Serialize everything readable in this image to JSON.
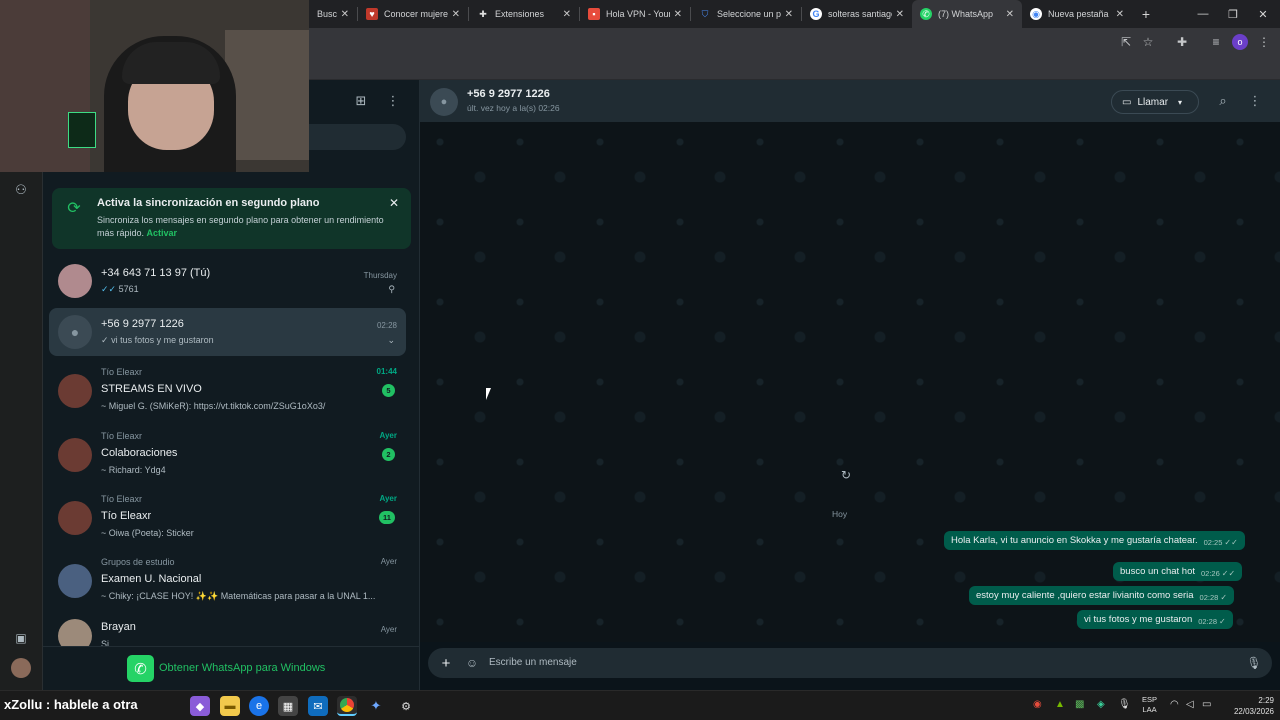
{
  "browser": {
    "tabs": [
      {
        "label": "Busca",
        "icon": "search-icon",
        "color": "#4a5a6a"
      },
      {
        "label": "Conocer mujeres",
        "icon": "dating-site-icon",
        "color": "#c0392b"
      },
      {
        "label": "Extensiones",
        "icon": "puzzle-icon",
        "color": "#5f6368"
      },
      {
        "label": "Hola VPN - Your V",
        "icon": "vpn-icon",
        "color": "#e74c3c"
      },
      {
        "label": "Seleccione un pla",
        "icon": "shield-icon",
        "color": "#1a73e8"
      },
      {
        "label": "solteras santiago",
        "icon": "google-icon",
        "color": "#ffffff"
      },
      {
        "label": "(7) WhatsApp",
        "icon": "whatsapp-icon",
        "color": "#25d366",
        "active": true
      },
      {
        "label": "Nueva pestaña",
        "icon": "chrome-icon",
        "color": "#ffffff"
      }
    ],
    "new_tab": "+",
    "profile_initial": "o"
  },
  "whatsapp": {
    "banner": {
      "title": "Activa la sincronización en segundo plano",
      "body": "Sincroniza los mensajes en segundo plano para obtener un rendimiento más rápido.",
      "action": "Activar"
    },
    "chats": [
      {
        "name": "+34 643 71 13 97 (Tú)",
        "preview": "5761",
        "time": "Thursday",
        "pinned": true
      },
      {
        "name": "+56 9 2977 1226",
        "preview": "vi tus fotos y me gustaron",
        "time": "02:28",
        "selected": true
      },
      {
        "group": "Tío Eleaxr",
        "name": "STREAMS EN VIVO",
        "preview": "~ Miguel G. (SMiKeR): https://vt.tiktok.com/ZSuG1oXo3/",
        "time": "01:44",
        "unread": "5"
      },
      {
        "group": "Tío Eleaxr",
        "name": "Colaboraciones",
        "preview": "~ Richard: Ydg4",
        "time": "Ayer",
        "unread": "2"
      },
      {
        "group": "Tío Eleaxr",
        "name": "Tío Eleaxr",
        "preview": "~ Oiwa (Poeta):  Sticker",
        "time": "Ayer",
        "unread": "11"
      },
      {
        "group": "Grupos de estudio",
        "name": "Examen U. Nacional",
        "preview": "~ Chiky:  ¡CLASE HOY! ✨✨ Matemáticas para pasar a la UNAL 1...",
        "time": "Ayer"
      },
      {
        "name": "Brayan",
        "preview": "Si",
        "time": "Ayer"
      }
    ],
    "get_app": "Obtener WhatsApp para Windows",
    "header": {
      "name": "+56 9 2977 1226",
      "status": "últ. vez hoy a la(s) 02:26",
      "call": "Llamar"
    },
    "day_label": "Hoy",
    "messages": [
      {
        "text": "Hola Karla, vi tu anuncio en Skokka y me gustaría chatear.",
        "time": "02:25"
      },
      {
        "text": "busco un chat hot",
        "time": "02:26"
      },
      {
        "text": "estoy muy caliente ,quiero estar livianito como seria",
        "time": "02:28"
      },
      {
        "text": "vi tus fotos y me gustaron",
        "time": "02:28"
      }
    ],
    "composer_placeholder": "Escribe un mensaje"
  },
  "overlay": {
    "ticker": "xZollu : hablele a otra"
  },
  "taskbar": {
    "lang": "ESP",
    "layout": "LAA",
    "time": "2:29",
    "date": "22/03/2026"
  }
}
